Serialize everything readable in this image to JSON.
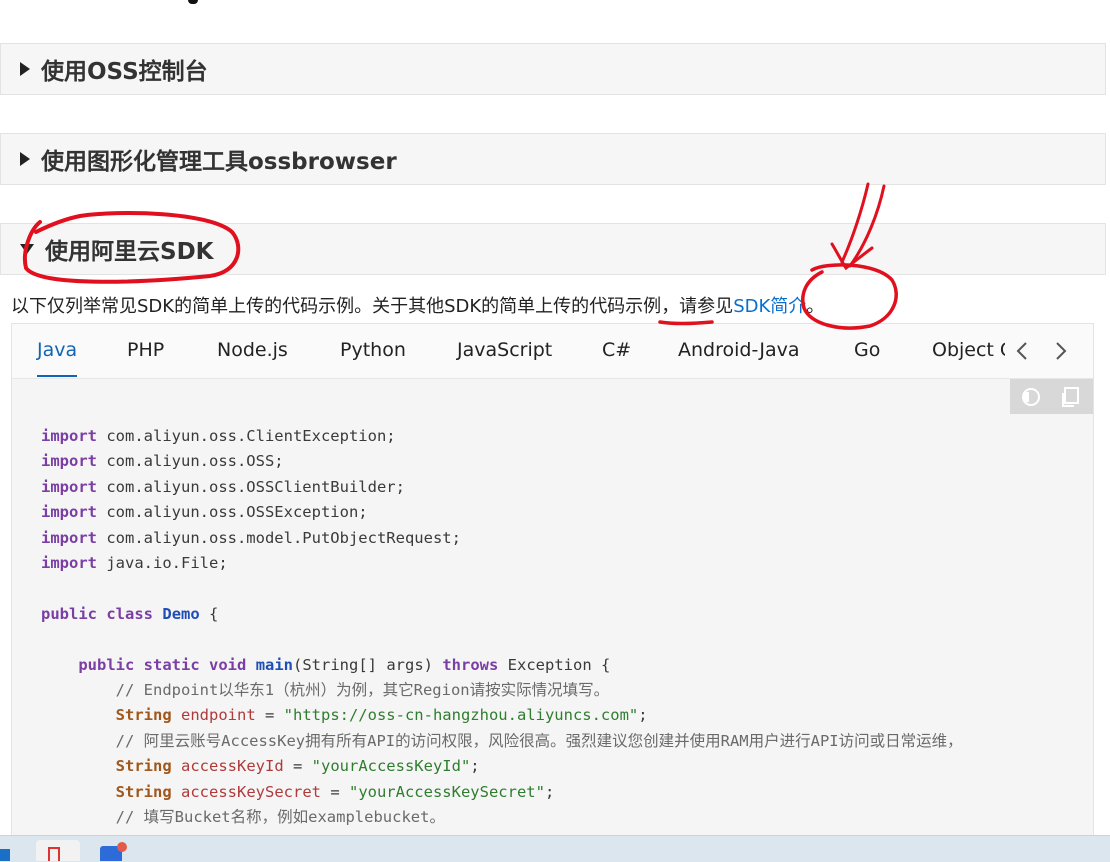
{
  "sections": [
    {
      "title": "使用OSS控制台",
      "expanded": false
    },
    {
      "title": "使用图形化管理工具ossbrowser",
      "expanded": false
    },
    {
      "title": "使用阿里云SDK",
      "expanded": true
    }
  ],
  "intro": {
    "text_before": "以下仅列举常见SDK的简单上传的代码示例。关于其他SDK的简单上传的",
    "underlined": "代码示例",
    "text_after": "，请参见",
    "link": "SDK简介",
    "period": "。"
  },
  "tabs": [
    "Java",
    "PHP",
    "Node.js",
    "Python",
    "JavaScript",
    "C#",
    "Android-Java",
    "Go",
    "Object C"
  ],
  "active_tab": "Java",
  "code": {
    "lines": [
      {
        "tokens": [
          {
            "t": "kw",
            "v": "import"
          },
          {
            "t": "pl",
            "v": " com.aliyun.oss.ClientException;"
          }
        ]
      },
      {
        "tokens": [
          {
            "t": "kw",
            "v": "import"
          },
          {
            "t": "pl",
            "v": " com.aliyun.oss.OSS;"
          }
        ]
      },
      {
        "tokens": [
          {
            "t": "kw",
            "v": "import"
          },
          {
            "t": "pl",
            "v": " com.aliyun.oss.OSSClientBuilder;"
          }
        ]
      },
      {
        "tokens": [
          {
            "t": "kw",
            "v": "import"
          },
          {
            "t": "pl",
            "v": " com.aliyun.oss.OSSException;"
          }
        ]
      },
      {
        "tokens": [
          {
            "t": "kw",
            "v": "import"
          },
          {
            "t": "pl",
            "v": " com.aliyun.oss.model.PutObjectRequest;"
          }
        ]
      },
      {
        "tokens": [
          {
            "t": "kw",
            "v": "import"
          },
          {
            "t": "pl",
            "v": " java.io.File;"
          }
        ]
      },
      {
        "tokens": []
      },
      {
        "tokens": [
          {
            "t": "kw",
            "v": "public"
          },
          {
            "t": "pl",
            "v": " "
          },
          {
            "t": "kw",
            "v": "class"
          },
          {
            "t": "pl",
            "v": " "
          },
          {
            "t": "fn",
            "v": "Demo"
          },
          {
            "t": "pl",
            "v": " {"
          }
        ]
      },
      {
        "tokens": []
      },
      {
        "tokens": [
          {
            "t": "pl",
            "v": "    "
          },
          {
            "t": "kw",
            "v": "public"
          },
          {
            "t": "pl",
            "v": " "
          },
          {
            "t": "kw",
            "v": "static"
          },
          {
            "t": "pl",
            "v": " "
          },
          {
            "t": "kw",
            "v": "void"
          },
          {
            "t": "pl",
            "v": " "
          },
          {
            "t": "fn",
            "v": "main"
          },
          {
            "t": "pl",
            "v": "(String[] args) "
          },
          {
            "t": "kw",
            "v": "throws"
          },
          {
            "t": "pl",
            "v": " Exception {"
          }
        ]
      },
      {
        "tokens": [
          {
            "t": "pl",
            "v": "        "
          },
          {
            "t": "com",
            "v": "// Endpoint以华东1（杭州）为例，其它Region请按实际情况填写。"
          }
        ]
      },
      {
        "tokens": [
          {
            "t": "pl",
            "v": "        "
          },
          {
            "t": "ty",
            "v": "String"
          },
          {
            "t": "pl",
            "v": " "
          },
          {
            "t": "var",
            "v": "endpoint"
          },
          {
            "t": "pl",
            "v": " = "
          },
          {
            "t": "str",
            "v": "\"https://oss-cn-hangzhou.aliyuncs.com\""
          },
          {
            "t": "pl",
            "v": ";"
          }
        ]
      },
      {
        "tokens": [
          {
            "t": "pl",
            "v": "        "
          },
          {
            "t": "com",
            "v": "// 阿里云账号AccessKey拥有所有API的访问权限，风险很高。强烈建议您创建并使用RAM用户进行API访问或日常运维，"
          }
        ]
      },
      {
        "tokens": [
          {
            "t": "pl",
            "v": "        "
          },
          {
            "t": "ty",
            "v": "String"
          },
          {
            "t": "pl",
            "v": " "
          },
          {
            "t": "var",
            "v": "accessKeyId"
          },
          {
            "t": "pl",
            "v": " = "
          },
          {
            "t": "str",
            "v": "\"yourAccessKeyId\""
          },
          {
            "t": "pl",
            "v": ";"
          }
        ]
      },
      {
        "tokens": [
          {
            "t": "pl",
            "v": "        "
          },
          {
            "t": "ty",
            "v": "String"
          },
          {
            "t": "pl",
            "v": " "
          },
          {
            "t": "var",
            "v": "accessKeySecret"
          },
          {
            "t": "pl",
            "v": " = "
          },
          {
            "t": "str",
            "v": "\"yourAccessKeySecret\""
          },
          {
            "t": "pl",
            "v": ";"
          }
        ]
      },
      {
        "tokens": [
          {
            "t": "pl",
            "v": "        "
          },
          {
            "t": "com",
            "v": "// 填写Bucket名称，例如examplebucket。"
          }
        ]
      }
    ]
  },
  "colors": {
    "link": "#0a6ecd",
    "active_tab": "#1264b4",
    "annotation": "#e0101e",
    "keyword": "#7a3ea5",
    "string": "#2f7d2f"
  },
  "icons": [
    "prev-tab-chevron-icon",
    "next-tab-chevron-icon",
    "theme-toggle-icon",
    "copy-icon"
  ]
}
